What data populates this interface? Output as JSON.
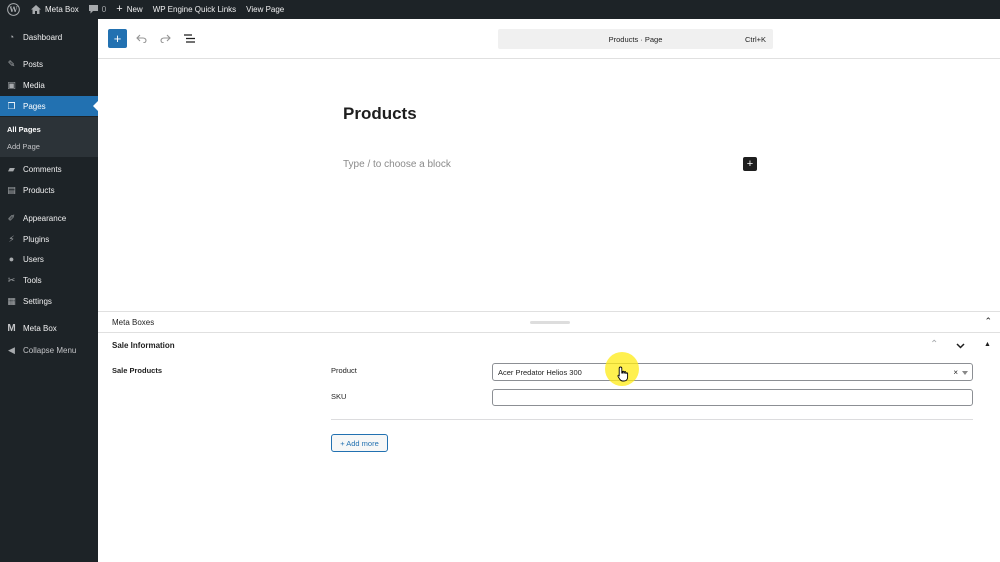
{
  "adminbar": {
    "site_name": "Meta Box",
    "comments_count": "0",
    "new_label": "New",
    "quick_links": "WP Engine Quick Links",
    "view_page": "View Page"
  },
  "sidebar": {
    "items": [
      {
        "label": "Dashboard",
        "icon": "dashboard-icon"
      },
      {
        "label": "Posts",
        "icon": "pin-icon"
      },
      {
        "label": "Media",
        "icon": "media-icon"
      },
      {
        "label": "Pages",
        "icon": "pages-icon"
      },
      {
        "label": "Comments",
        "icon": "comment-icon"
      },
      {
        "label": "Products",
        "icon": "archive-icon"
      },
      {
        "label": "Appearance",
        "icon": "brush-icon"
      },
      {
        "label": "Plugins",
        "icon": "plugin-icon"
      },
      {
        "label": "Users",
        "icon": "user-icon"
      },
      {
        "label": "Tools",
        "icon": "wrench-icon"
      },
      {
        "label": "Settings",
        "icon": "settings-icon"
      },
      {
        "label": "Meta Box",
        "icon": "metabox-logo-icon"
      },
      {
        "label": "Collapse Menu",
        "icon": "collapse-icon"
      }
    ],
    "submenu": {
      "all_pages": "All Pages",
      "add_page": "Add Page"
    }
  },
  "header": {
    "document_title": "Products · Page",
    "shortcut": "Ctrl+K"
  },
  "editor": {
    "title": "Products",
    "placeholder": "Type / to choose a block"
  },
  "metaboxes": {
    "handle_label": "Meta Boxes",
    "postbox_title": "Sale Information",
    "group_label": "Sale Products",
    "product_label": "Product",
    "product_value": "Acer Predator Helios 300",
    "clear_symbol": "×",
    "sku_label": "SKU",
    "sku_value": "",
    "add_more": "+ Add more"
  },
  "colors": {
    "admin_dark": "#1d2327",
    "accent": "#2271b1",
    "cursor_highlight": "#ffeb14"
  }
}
